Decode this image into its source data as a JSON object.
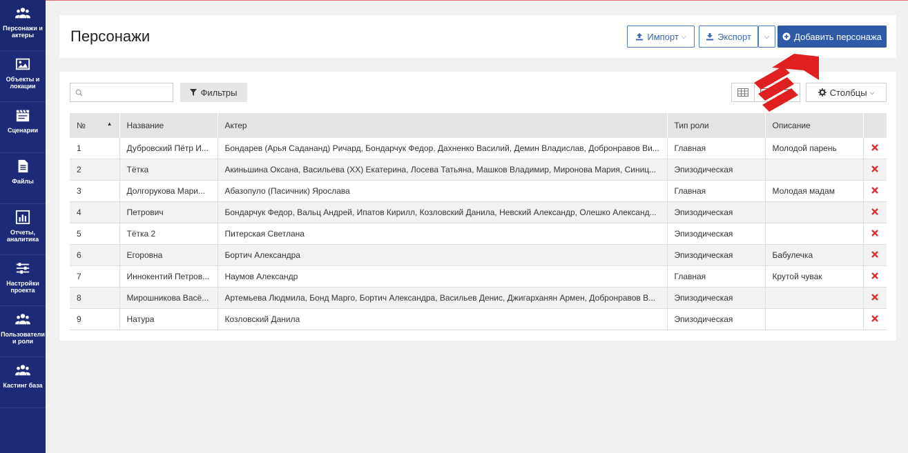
{
  "sidebar": {
    "items": [
      {
        "label": "Персонажи и актеры",
        "icon": "users-icon"
      },
      {
        "label": "Объекты и локации",
        "icon": "image-icon"
      },
      {
        "label": "Сценарии",
        "icon": "clapperboard-icon"
      },
      {
        "label": "Файлы",
        "icon": "file-icon"
      },
      {
        "label": "Отчеты, аналитика",
        "icon": "chart-icon"
      },
      {
        "label": "Настройки проекта",
        "icon": "sliders-icon"
      },
      {
        "label": "Пользователи и роли",
        "icon": "users-icon"
      },
      {
        "label": "Кастинг база",
        "icon": "users-icon"
      }
    ]
  },
  "header": {
    "title": "Персонажи",
    "import_label": "Импорт",
    "export_label": "Экспорт",
    "add_label": "Добавить персонажа"
  },
  "toolbar": {
    "search_placeholder": "",
    "filters_label": "Фильтры",
    "columns_label": "Столбцы"
  },
  "table": {
    "headers": [
      "№",
      "Название",
      "Актер",
      "Тип роли",
      "Описание"
    ],
    "rows": [
      {
        "n": "1",
        "name": "Дубровский Пётр И...",
        "actor": "Бондарев (Арья Садананд) Ричард, Бондарчук Федор, Дахненко Василий, Демин Владислав, Добронравов Ви...",
        "role": "Главная",
        "desc": "Молодой парень"
      },
      {
        "n": "2",
        "name": "Тётка",
        "actor": "Акиньшина Оксана, Васильева (XX) Екатерина, Лосева Татьяна, Машков Владимир, Миронова Мария, Синиц...",
        "role": "Эпизодическая",
        "desc": ""
      },
      {
        "n": "3",
        "name": "Долгорукова Мари...",
        "actor": "Абазопуло (Пасичник) Ярослава",
        "role": "Главная",
        "desc": "Молодая мадам"
      },
      {
        "n": "4",
        "name": "Петрович",
        "actor": "Бондарчук Федор, Вальц Андрей, Ипатов Кирилл, Козловский Данила, Невский Александр, Олешко Александ...",
        "role": "Эпизодическая",
        "desc": ""
      },
      {
        "n": "5",
        "name": "Тётка 2",
        "actor": "Питерская Светлана",
        "role": "Эпизодическая",
        "desc": ""
      },
      {
        "n": "6",
        "name": "Егоровна",
        "actor": "Бортич Александра",
        "role": "Эпизодическая",
        "desc": "Бабулечка"
      },
      {
        "n": "7",
        "name": "Иннокентий Петров...",
        "actor": "Наумов Александр",
        "role": "Главная",
        "desc": "Крутой чувак"
      },
      {
        "n": "8",
        "name": "Мирошникова Васё...",
        "actor": "Артемьева Людмила, Бонд Марго, Бортич Александра, Васильев Денис, Джигарханян Армен, Добронравов В...",
        "role": "Эпизодическая",
        "desc": ""
      },
      {
        "n": "9",
        "name": "Натура",
        "actor": "Козловский Данила",
        "role": "Эпизодическая",
        "desc": ""
      }
    ]
  },
  "colors": {
    "sidebar_bg": "#1c2a78",
    "primary": "#2e5aa8",
    "delete": "#e03030",
    "annotation": "#e02020"
  }
}
